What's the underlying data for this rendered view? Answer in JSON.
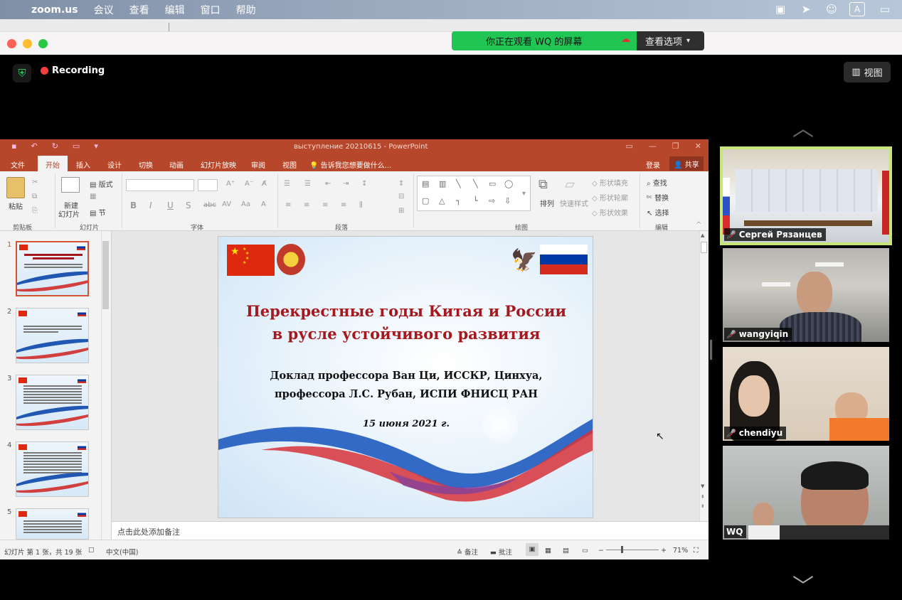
{
  "menubar": {
    "app": "zoom.us",
    "items": [
      "会议",
      "查看",
      "编辑",
      "窗口",
      "帮助"
    ]
  },
  "share_banner": {
    "watching": "你正在观看 WQ 的屏幕",
    "view_options": "查看选项"
  },
  "meeting": {
    "recording_label": "Recording",
    "view_button": "视图"
  },
  "ppt": {
    "window_title": "выступление 20210615 - PowerPoint",
    "tabs": [
      "文件",
      "开始",
      "插入",
      "设计",
      "切换",
      "动画",
      "幻灯片放映",
      "审阅",
      "视图"
    ],
    "active_tab": "开始",
    "tell_me": "告诉我您想要做什么...",
    "login": "登录",
    "share": "共享",
    "ribbon": {
      "paste": "粘贴",
      "clipboard_group": "剪贴板",
      "new_slide_1": "新建",
      "new_slide_2": "幻灯片",
      "layout": "版式",
      "section": "节",
      "slides_group": "幻灯片",
      "font_group": "字体",
      "paragraph_group": "段落",
      "arrange": "排列",
      "quick_styles": "快速样式",
      "shape_fill": "形状填充",
      "shape_outline": "形状轮廓",
      "shape_effects": "形状效果",
      "drawing_group": "绘图",
      "find": "查找",
      "replace": "替换",
      "select": "选择",
      "editing_group": "编辑"
    },
    "slide_numbers": [
      "1",
      "2",
      "3",
      "4",
      "5"
    ],
    "slide": {
      "title_line1": "Перекрестные годы Китая и России",
      "title_line2": "в русле устойчивого развития",
      "sub_line1": "Доклад профессора Ван Ци, ИССКР, Цинхуа,",
      "sub_line2": "профессора Л.С. Рубан, ИСПИ ФНИСЦ РАН",
      "date": "15 июня 2021 г."
    },
    "notes_placeholder": "点击此处添加备注",
    "status": {
      "slide_count": "幻灯片 第 1 张，共 19 张",
      "language": "中文(中国)",
      "notes": "备注",
      "comments": "批注",
      "zoom": "71%"
    }
  },
  "participants": [
    {
      "name": "Сергей Рязанцев",
      "muted": true,
      "active": true
    },
    {
      "name": "wangyiqin",
      "muted": true,
      "active": false
    },
    {
      "name": "chendiyu",
      "muted": true,
      "active": false
    },
    {
      "name": "WQ",
      "muted": false,
      "active": false
    }
  ]
}
